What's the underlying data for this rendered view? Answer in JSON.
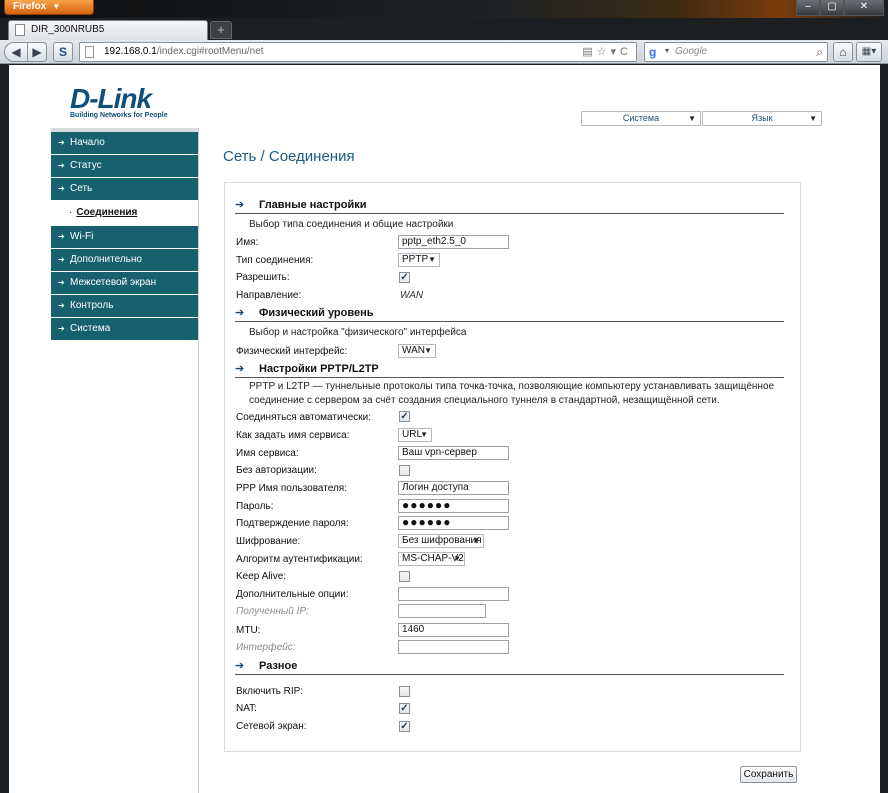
{
  "browser": {
    "app_button": "Firefox",
    "tab_title": "DIR_300NRUB5",
    "url_host": "192.168.0.1",
    "url_path": "/index.cgi#rootMenu/net",
    "search_placeholder": "Google"
  },
  "header": {
    "logo_text": "D-Link",
    "logo_tagline": "Building Networks for People",
    "system_select": "Система",
    "language_select": "Язык"
  },
  "sidebar": {
    "items": [
      {
        "label": "Начало"
      },
      {
        "label": "Статус"
      },
      {
        "label": "Сеть"
      },
      {
        "label": "Соединения"
      },
      {
        "label": "Wi-Fi"
      },
      {
        "label": "Дополнительно"
      },
      {
        "label": "Межсетевой экран"
      },
      {
        "label": "Контроль"
      },
      {
        "label": "Система"
      }
    ]
  },
  "main": {
    "title": "Сеть  /  Соединения",
    "sections": {
      "general": {
        "title": "Главные настройки",
        "desc": "Выбор типа соединения и общие настройки",
        "name_label": "Имя:",
        "name_value": "pptp_eth2.5_0",
        "type_label": "Тип соединения:",
        "type_value": "PPTP",
        "enable_label": "Разрешить:",
        "direction_label": "Направление:",
        "direction_value": "WAN"
      },
      "physical": {
        "title": "Физический уровень",
        "desc": "Выбор и настройка \"физического\" интерфейса",
        "iface_label": "Физический интерфейс:",
        "iface_value": "WAN"
      },
      "pptp": {
        "title": "Настройки PPTP/L2TP",
        "desc": "PPTP и L2TP — туннельные протоколы типа точка-точка, позволяющие компьютеру устанавливать защищённое соединение с сервером за счёт создания специального туннеля в стандартной, незащищённой сети.",
        "auto_label": "Соединяться автоматически:",
        "service_mode_label": "Как задать имя сервиса:",
        "service_mode_value": "URL",
        "service_name_label": "Имя сервиса:",
        "service_name_value": "Ваш vpn-сервер",
        "noauth_label": "Без авторизации:",
        "user_label": "PPP Имя пользователя:",
        "user_value": "Логин доступа",
        "password_label": "Пароль:",
        "password_value": "●●●●●●",
        "confirm_label": "Подтверждение пароля:",
        "confirm_value": "●●●●●●",
        "encryption_label": "Шифрование:",
        "encryption_value": "Без шифрования",
        "auth_label": "Алгоритм аутентификации:",
        "auth_value": "MS-CHAP-V2",
        "keepalive_label": "Keep Alive:",
        "extra_label": "Дополнительные опции:",
        "extra_value": "",
        "ip_label": "Полученный IP:",
        "ip_value": "",
        "mtu_label": "MTU:",
        "mtu_value": "1460",
        "iface_label": "Интерфейс:",
        "iface_value": ""
      },
      "misc": {
        "title": "Разное",
        "rip_label": "Включить RIP:",
        "nat_label": "NAT:",
        "firewall_label": "Сетевой экран:"
      }
    },
    "save_label": "Сохранить"
  },
  "colors": {
    "nav_bg": "#17606e",
    "title_blue": "#1c5a83",
    "logo_blue": "#0f4f7c"
  }
}
